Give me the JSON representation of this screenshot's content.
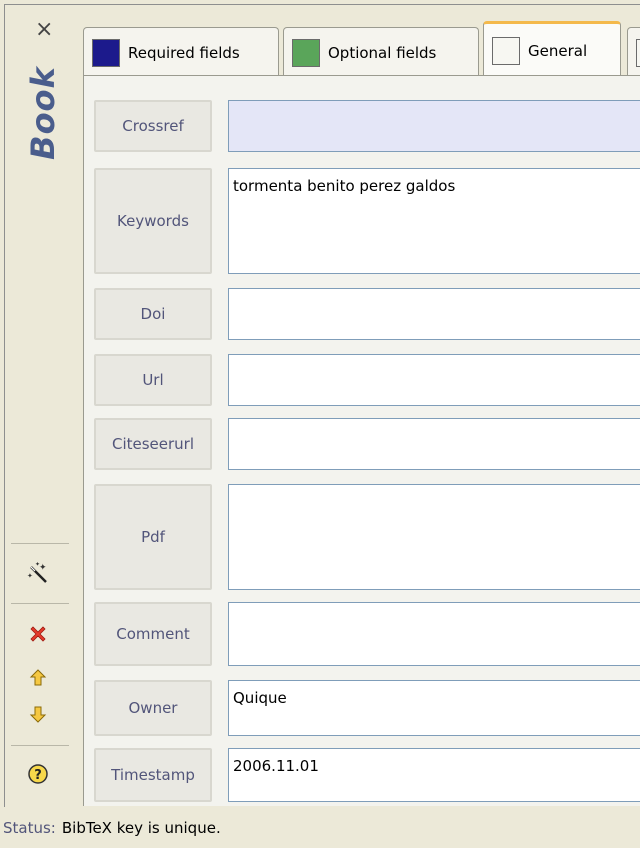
{
  "sidebar": {
    "entry_type": "Book",
    "close_glyph": "×"
  },
  "tabs": [
    {
      "label": "Required fields",
      "color": "#1c1a8c"
    },
    {
      "label": "Optional fields",
      "color": "#5aa55a"
    },
    {
      "label": "General",
      "color": "#f7f7f2"
    }
  ],
  "fields": {
    "crossref": {
      "label": "Crossref",
      "value": ""
    },
    "keywords": {
      "label": "Keywords",
      "value": "tormenta benito perez galdos"
    },
    "doi": {
      "label": "Doi",
      "value": ""
    },
    "url": {
      "label": "Url",
      "value": ""
    },
    "citeseerurl": {
      "label": "Citeseerurl",
      "value": ""
    },
    "pdf": {
      "label": "Pdf",
      "value": ""
    },
    "comment": {
      "label": "Comment",
      "value": ""
    },
    "owner": {
      "label": "Owner",
      "value": "Quique"
    },
    "timestamp": {
      "label": "Timestamp",
      "value": "2006.11.01"
    }
  },
  "status": {
    "key": "Status:",
    "message": "BibTeX key is unique."
  }
}
